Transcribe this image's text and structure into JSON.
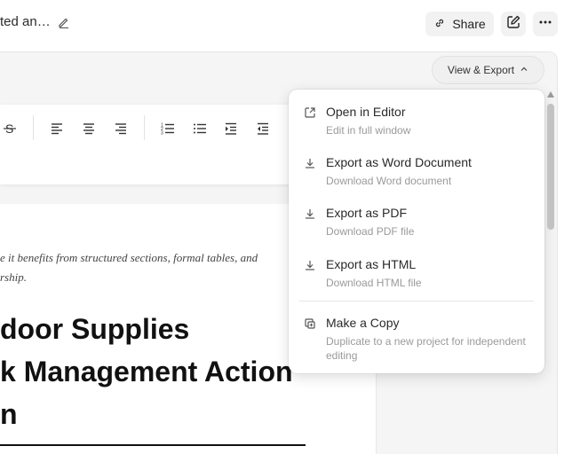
{
  "header": {
    "title": "ted an…",
    "share_label": "Share",
    "icons": [
      "pencil-icon",
      "link-icon",
      "compose-icon",
      "more-horizontal-icon"
    ]
  },
  "toolbar": {
    "view_export_label": "View & Export",
    "icons": [
      "strikethrough-icon",
      "align-left-icon",
      "align-center-icon",
      "align-right-icon",
      "ordered-list-icon",
      "bullet-list-icon",
      "indent-icon",
      "outdent-icon"
    ]
  },
  "document": {
    "intro_line1": "e it benefits from structured sections, formal tables, and",
    "intro_line2": "rship.",
    "heading_line1": "door Supplies",
    "heading_line2": "k Management Action",
    "heading_line3": "n"
  },
  "menu": {
    "items": [
      {
        "label": "Open in Editor",
        "desc": "Edit in full window",
        "icon": "external-link-icon"
      },
      {
        "label": "Export as Word Document",
        "desc": "Download Word document",
        "icon": "download-icon"
      },
      {
        "label": "Export as PDF",
        "desc": "Download PDF file",
        "icon": "download-icon"
      },
      {
        "label": "Export as HTML",
        "desc": "Download HTML file",
        "icon": "download-icon"
      },
      {
        "label": "Make a Copy",
        "desc": "Duplicate to a new project for independent editing",
        "icon": "copy-icon"
      }
    ]
  },
  "colors": {
    "page_bg": "#ffffff",
    "workspace_bg": "#f5f5f5",
    "button_bg": "#f2f2f2",
    "muted_text": "#9a9a9a"
  }
}
